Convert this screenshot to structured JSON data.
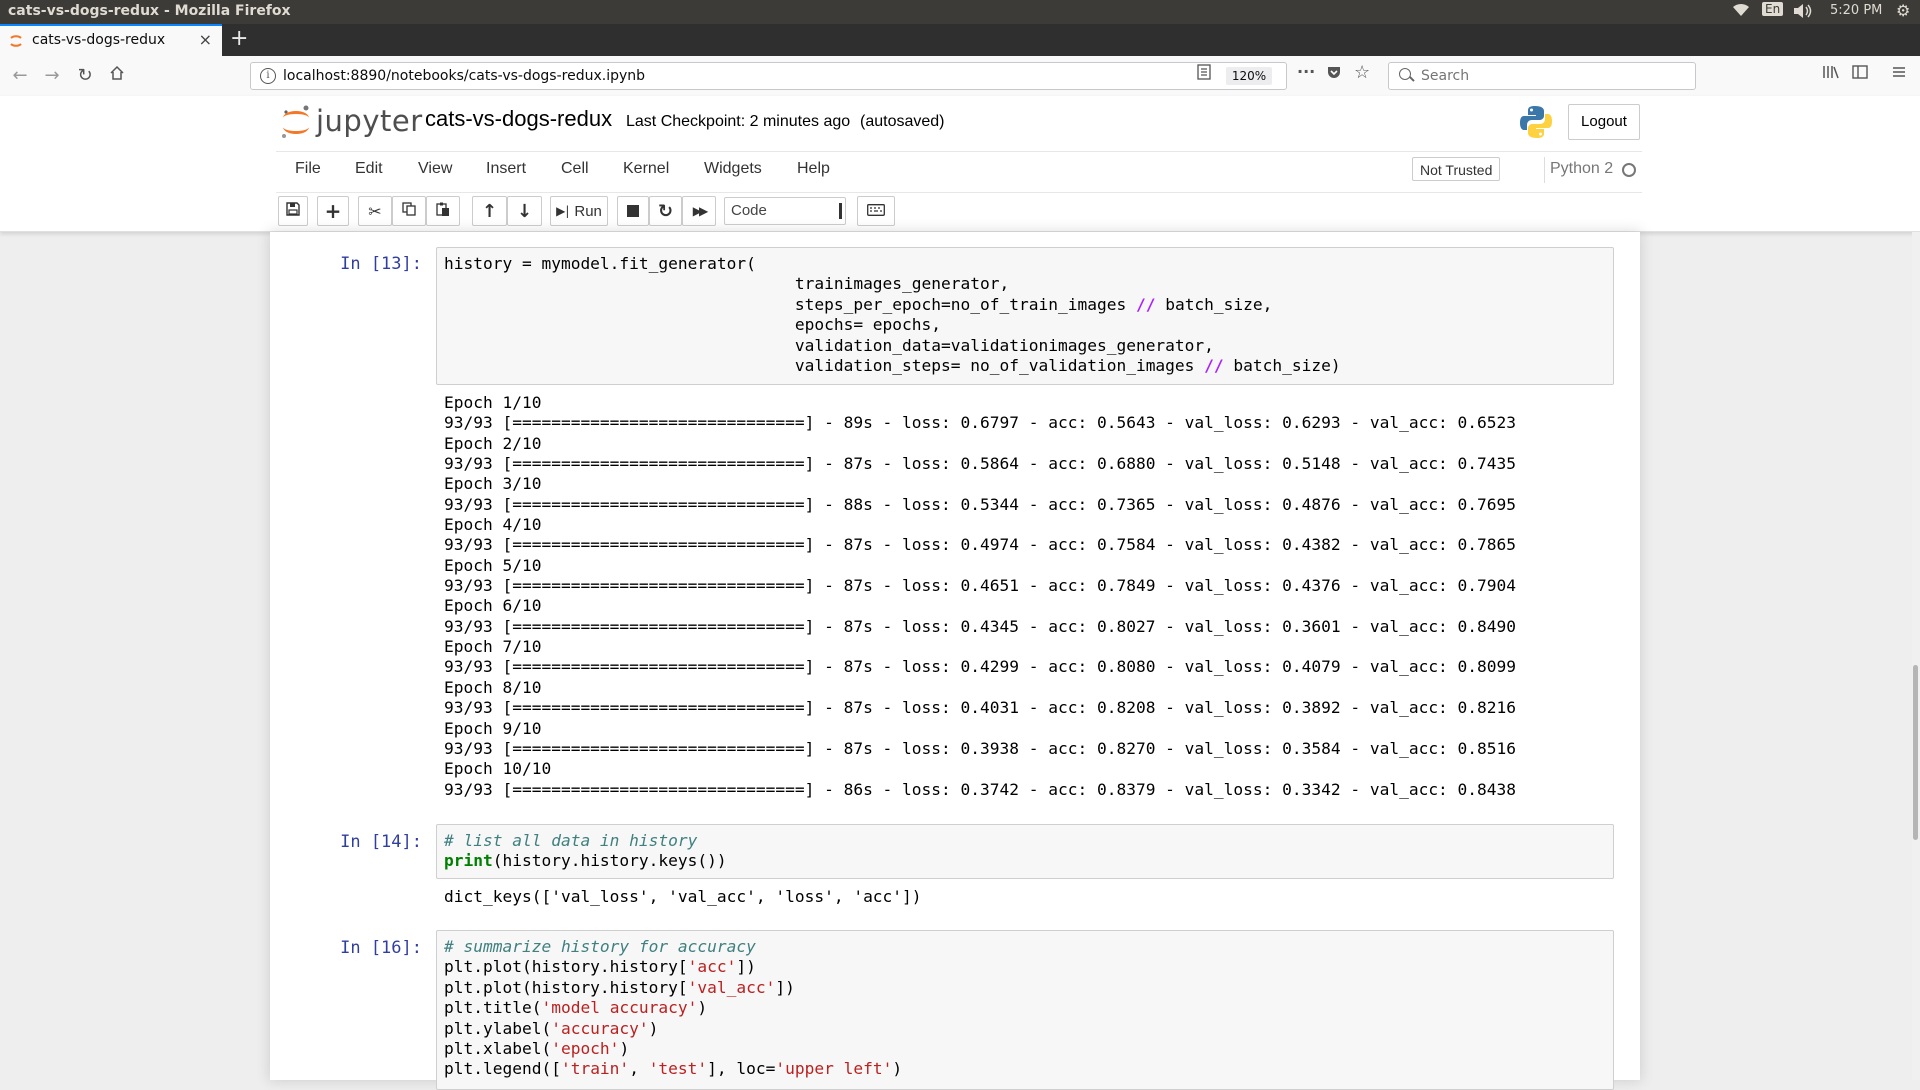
{
  "os": {
    "window_title": "cats-vs-dogs-redux - Mozilla Firefox",
    "lang": "En",
    "clock": "5:20 PM"
  },
  "browser": {
    "tab_title": "cats-vs-dogs-redux",
    "url": "localhost:8890/notebooks/cats-vs-dogs-redux.ipynb",
    "zoom": "120%",
    "search_placeholder": "Search"
  },
  "jupyter": {
    "logo_text": "jupyter",
    "notebook_name": "cats-vs-dogs-redux",
    "checkpoint": "Last Checkpoint: 2 minutes ago",
    "autosave": "(autosaved)",
    "logout": "Logout",
    "menu": [
      "File",
      "Edit",
      "View",
      "Insert",
      "Cell",
      "Kernel",
      "Widgets",
      "Help"
    ],
    "trust": "Not Trusted",
    "kernel": "Python 2",
    "run_label": "Run",
    "cell_type": "Code"
  },
  "cells": [
    {
      "prompt": "In [13]:",
      "code": [
        "history = mymodel.fit_generator(",
        "                                    trainimages_generator,",
        "                                    steps_per_epoch=no_of_train_images // batch_size,",
        "                                    epochs= epochs,",
        "                                    validation_data=validationimages_generator,",
        "                                    validation_steps= no_of_validation_images // batch_size)"
      ],
      "output": [
        "Epoch 1/10",
        "93/93 [==============================] - 89s - loss: 0.6797 - acc: 0.5643 - val_loss: 0.6293 - val_acc: 0.6523",
        "Epoch 2/10",
        "93/93 [==============================] - 87s - loss: 0.5864 - acc: 0.6880 - val_loss: 0.5148 - val_acc: 0.7435",
        "Epoch 3/10",
        "93/93 [==============================] - 88s - loss: 0.5344 - acc: 0.7365 - val_loss: 0.4876 - val_acc: 0.7695",
        "Epoch 4/10",
        "93/93 [==============================] - 87s - loss: 0.4974 - acc: 0.7584 - val_loss: 0.4382 - val_acc: 0.7865",
        "Epoch 5/10",
        "93/93 [==============================] - 87s - loss: 0.4651 - acc: 0.7849 - val_loss: 0.4376 - val_acc: 0.7904",
        "Epoch 6/10",
        "93/93 [==============================] - 87s - loss: 0.4345 - acc: 0.8027 - val_loss: 0.3601 - val_acc: 0.8490",
        "Epoch 7/10",
        "93/93 [==============================] - 87s - loss: 0.4299 - acc: 0.8080 - val_loss: 0.4079 - val_acc: 0.8099",
        "Epoch 8/10",
        "93/93 [==============================] - 87s - loss: 0.4031 - acc: 0.8208 - val_loss: 0.3892 - val_acc: 0.8216",
        "Epoch 9/10",
        "93/93 [==============================] - 87s - loss: 0.3938 - acc: 0.8270 - val_loss: 0.3584 - val_acc: 0.8516",
        "Epoch 10/10",
        "93/93 [==============================] - 86s - loss: 0.3742 - acc: 0.8379 - val_loss: 0.3342 - val_acc: 0.8438"
      ]
    },
    {
      "prompt": "In [14]:",
      "code": [
        "# list all data in history",
        "print(history.history.keys())"
      ],
      "output": [
        "dict_keys(['val_loss', 'val_acc', 'loss', 'acc'])"
      ]
    },
    {
      "prompt": "In [16]:",
      "code": [
        "# summarize history for accuracy",
        "plt.plot(history.history['acc'])",
        "plt.plot(history.history['val_acc'])",
        "plt.title('model accuracy')",
        "plt.ylabel('accuracy')",
        "plt.xlabel('epoch')",
        "plt.legend(['train', 'test'], loc='upper left')"
      ],
      "output": []
    }
  ],
  "colors": {
    "prompt": "#303f9f",
    "comment": "#408080",
    "keyword": "#008000",
    "string": "#ba2121",
    "operator": "#aa22ff",
    "firefox_accent": "#0a84ff",
    "jupyter_orange": "#f37726"
  }
}
